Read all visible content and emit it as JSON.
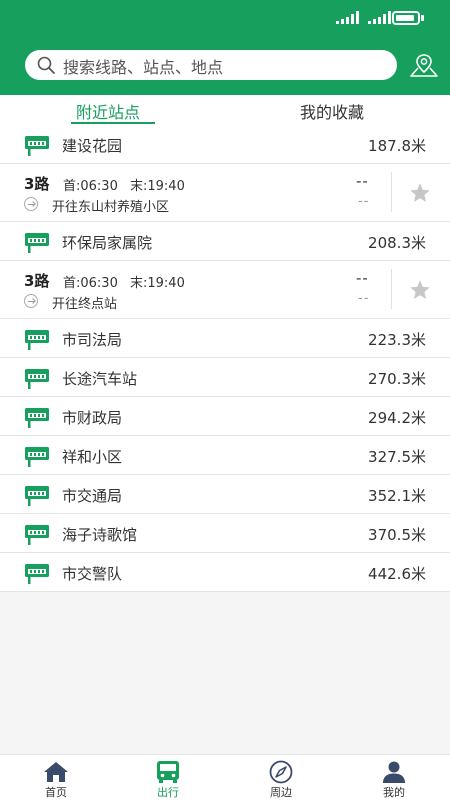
{
  "colors": {
    "brand": "#17a05d",
    "nav_icon": "#3a4a6b",
    "star": "#c7c7c7"
  },
  "search": {
    "placeholder": "搜索线路、站点、地点"
  },
  "tabs": [
    {
      "label": "附近站点",
      "active": true
    },
    {
      "label": "我的收藏",
      "active": false
    }
  ],
  "stations": [
    {
      "name": "建设花园",
      "distance": "187.8米"
    },
    {
      "name": "环保局家属院",
      "distance": "208.3米"
    },
    {
      "name": "市司法局",
      "distance": "223.3米"
    },
    {
      "name": "长途汽车站",
      "distance": "270.3米"
    },
    {
      "name": "市财政局",
      "distance": "294.2米"
    },
    {
      "name": "祥和小区",
      "distance": "327.5米"
    },
    {
      "name": "市交通局",
      "distance": "352.1米"
    },
    {
      "name": "海子诗歌馆",
      "distance": "370.5米"
    },
    {
      "name": "市交警队",
      "distance": "442.6米"
    }
  ],
  "routes": [
    {
      "number": "3路",
      "first": "首:06:30",
      "last": "末:19:40",
      "direction": "开往东山村养殖小区",
      "arrival": "--",
      "sub": "--"
    },
    {
      "number": "3路",
      "first": "首:06:30",
      "last": "末:19:40",
      "direction": "开往终点站",
      "arrival": "--",
      "sub": "--"
    }
  ],
  "nav": [
    {
      "label": "首页",
      "icon": "home-icon",
      "active": false
    },
    {
      "label": "出行",
      "icon": "bus-icon",
      "active": true
    },
    {
      "label": "周边",
      "icon": "compass-icon",
      "active": false
    },
    {
      "label": "我的",
      "icon": "user-icon",
      "active": false
    }
  ]
}
